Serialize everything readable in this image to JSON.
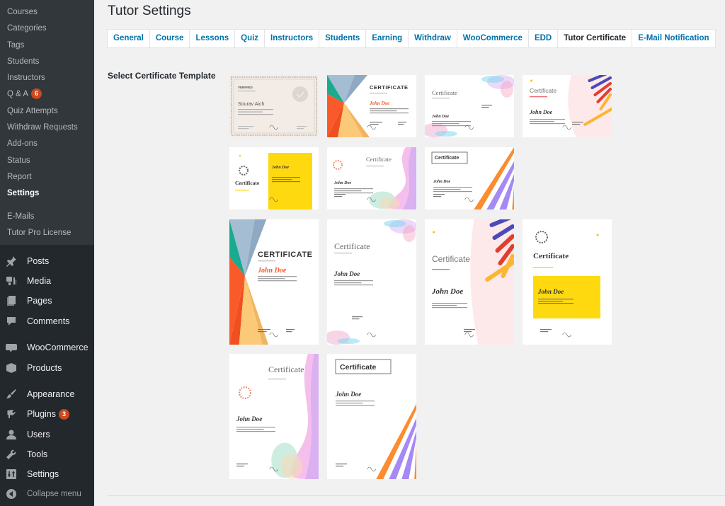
{
  "sidebar": {
    "submenu": [
      {
        "label": "Courses"
      },
      {
        "label": "Categories"
      },
      {
        "label": "Tags"
      },
      {
        "label": "Students"
      },
      {
        "label": "Instructors"
      },
      {
        "label": "Q & A",
        "badge": "6"
      },
      {
        "label": "Quiz Attempts"
      },
      {
        "label": "Withdraw Requests"
      },
      {
        "label": "Add-ons"
      },
      {
        "label": "Status"
      },
      {
        "label": "Report"
      },
      {
        "label": "Settings",
        "current": true
      },
      {
        "label": "E-Mails"
      },
      {
        "label": "Tutor Pro License"
      }
    ],
    "menu": [
      {
        "label": "Posts",
        "icon": "pin-icon"
      },
      {
        "label": "Media",
        "icon": "media-icon"
      },
      {
        "label": "Pages",
        "icon": "pages-icon"
      },
      {
        "label": "Comments",
        "icon": "comment-icon"
      },
      {
        "label": "WooCommerce",
        "icon": "woocommerce-icon"
      },
      {
        "label": "Products",
        "icon": "box-icon"
      },
      {
        "label": "Appearance",
        "icon": "brush-icon"
      },
      {
        "label": "Plugins",
        "icon": "plug-icon",
        "badge": "3"
      },
      {
        "label": "Users",
        "icon": "user-icon"
      },
      {
        "label": "Tools",
        "icon": "wrench-icon"
      },
      {
        "label": "Settings",
        "icon": "settings-icon"
      },
      {
        "label": "Collapse menu",
        "icon": "collapse-icon"
      }
    ]
  },
  "header": {
    "title": "Tutor Settings"
  },
  "tabs": [
    {
      "label": "General"
    },
    {
      "label": "Course"
    },
    {
      "label": "Lessons"
    },
    {
      "label": "Quiz"
    },
    {
      "label": "Instructors"
    },
    {
      "label": "Students"
    },
    {
      "label": "Earning"
    },
    {
      "label": "Withdraw"
    },
    {
      "label": "WooCommerce"
    },
    {
      "label": "EDD"
    },
    {
      "label": "Tutor Certificate",
      "active": true
    },
    {
      "label": "E-Mail Notification"
    }
  ],
  "section": {
    "label": "Select Certificate Template"
  },
  "templates": [
    {
      "id": "classic",
      "orientation": "landscape",
      "title": "VERIFIED",
      "name": "Sourav Aich",
      "style": "classic-border"
    },
    {
      "id": "geometric-landscape",
      "orientation": "landscape",
      "title": "CERTIFICATE",
      "name": "John Doe",
      "style": "geometric"
    },
    {
      "id": "floral-landscape",
      "orientation": "landscape",
      "title": "Certificate",
      "name": "John Doe",
      "style": "floral"
    },
    {
      "id": "pop-landscape",
      "orientation": "landscape",
      "title": "Certificate",
      "name": "John Doe",
      "style": "pop"
    },
    {
      "id": "yellow-landscape",
      "orientation": "landscape",
      "title": "Certificate",
      "name": "John Doe",
      "style": "yellow"
    },
    {
      "id": "wave-landscape",
      "orientation": "landscape",
      "title": "Certificate",
      "name": "John Doe",
      "style": "wave"
    },
    {
      "id": "stripes-landscape",
      "orientation": "landscape",
      "title": "Certificate",
      "name": "John Doe",
      "style": "stripes"
    },
    {
      "id": "geometric-portrait",
      "orientation": "portrait",
      "title": "CERTIFICATE",
      "name": "John Doe",
      "style": "geometric"
    },
    {
      "id": "floral-portrait",
      "orientation": "portrait",
      "title": "Certificate",
      "name": "John Doe",
      "style": "floral"
    },
    {
      "id": "pop-portrait",
      "orientation": "portrait",
      "title": "Certificate",
      "name": "John Doe",
      "style": "pop"
    },
    {
      "id": "yellow-portrait",
      "orientation": "portrait",
      "title": "Certificate",
      "name": "John Doe",
      "style": "yellow"
    },
    {
      "id": "wave-portrait",
      "orientation": "portrait",
      "title": "Certificate",
      "name": "John Doe",
      "style": "wave"
    },
    {
      "id": "stripes-portrait",
      "orientation": "portrait",
      "title": "Certificate",
      "name": "John Doe",
      "style": "stripes"
    }
  ],
  "colors": {
    "sidebar_bg": "#23282d",
    "submenu_bg": "#32373c",
    "link_blue": "#0073aa",
    "badge": "#ca4a1f"
  }
}
